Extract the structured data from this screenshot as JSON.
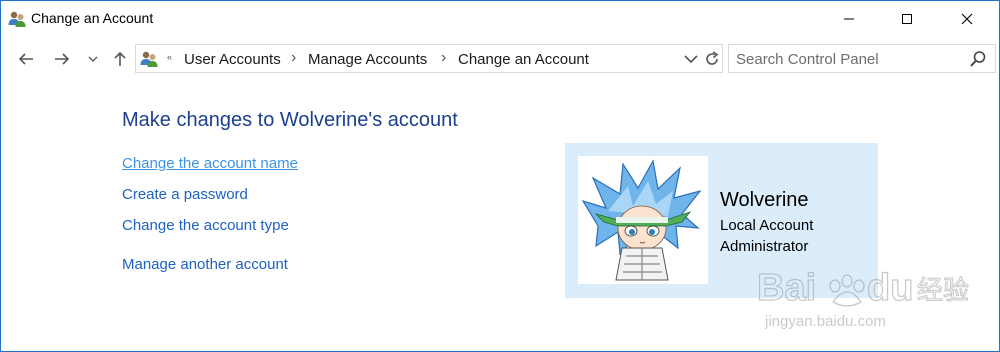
{
  "window": {
    "title": "Change an Account",
    "app_icon": "user-accounts-icon",
    "controls": [
      "minimize-icon",
      "maximize-icon",
      "close-icon"
    ]
  },
  "nav": {
    "back_icon": "arrow-left-icon",
    "forward_icon": "arrow-right-icon",
    "recent_icon": "chevron-down-icon",
    "up_icon": "arrow-up-icon"
  },
  "address": {
    "icon": "user-accounts-icon",
    "overflow": "«",
    "crumbs": [
      "User Accounts",
      "Manage Accounts",
      "Change an Account"
    ],
    "separator": "›"
  },
  "search": {
    "placeholder": "Search Control Panel",
    "icon": "search-icon"
  },
  "main": {
    "heading": "Make changes to Wolverine's account",
    "links": [
      "Change the account name",
      "Create a password",
      "Change the account type",
      "Manage another account"
    ]
  },
  "account": {
    "name": "Wolverine",
    "type": "Local Account",
    "role": "Administrator",
    "avatar_icon": "anime-character-avatar"
  },
  "watermark": {
    "brand": "Baidu",
    "brand_suffix": "经验",
    "url": "jingyan.baidu.com"
  },
  "colors": {
    "link": "#1e62c2",
    "link_hover": "#3d94e6",
    "heading": "#1e3f8f",
    "card_bg": "#dbedfb",
    "window_border": "#1e73c8"
  }
}
